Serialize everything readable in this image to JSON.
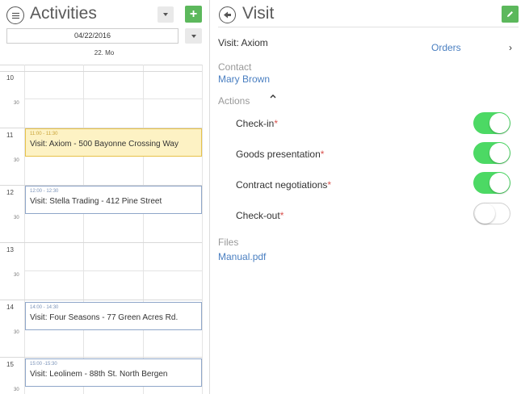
{
  "activities": {
    "title": "Activities",
    "date_value": "04/22/2016",
    "day_label": "22. Mo",
    "hours": [
      {
        "hour": "10",
        "half": "30"
      },
      {
        "hour": "11",
        "half": "30"
      },
      {
        "hour": "12",
        "half": "30"
      },
      {
        "hour": "13",
        "half": "30"
      },
      {
        "hour": "14",
        "half": "30"
      },
      {
        "hour": "15",
        "half": "30"
      }
    ],
    "events": [
      {
        "time": "11:00 - 11:30",
        "title": "Visit: Axiom - 500 Bayonne Crossing Way",
        "active": true
      },
      {
        "time": "12:00 - 12:30",
        "title": "Visit: Stella Trading - 412 Pine Street",
        "active": false
      },
      {
        "time": "14:00 - 14:30",
        "title": "Visit: Four Seasons - 77 Green Acres Rd.",
        "active": false
      },
      {
        "time": "15:00 -15:30",
        "title": "Visit: Leolinem - 88th St. North Bergen",
        "active": false
      }
    ]
  },
  "visit": {
    "title": "Visit",
    "name": "Visit: Axiom",
    "orders_label": "Orders",
    "contact_label": "Contact",
    "contact_value": "Mary Brown",
    "actions_label": "Actions",
    "actions": [
      {
        "label": "Check-in",
        "required": "*",
        "checked": true
      },
      {
        "label": "Goods presentation",
        "required": "*",
        "checked": true
      },
      {
        "label": "Contract negotiations",
        "required": "*",
        "checked": true
      },
      {
        "label": "Check-out",
        "required": "*",
        "checked": false
      }
    ],
    "files_label": "Files",
    "file_name": "Manual.pdf"
  },
  "colors": {
    "accent_green": "#5cb85c",
    "toggle_on": "#4cd964",
    "link_blue": "#4a7fc1",
    "event_active_bg": "#fdf2c4"
  }
}
